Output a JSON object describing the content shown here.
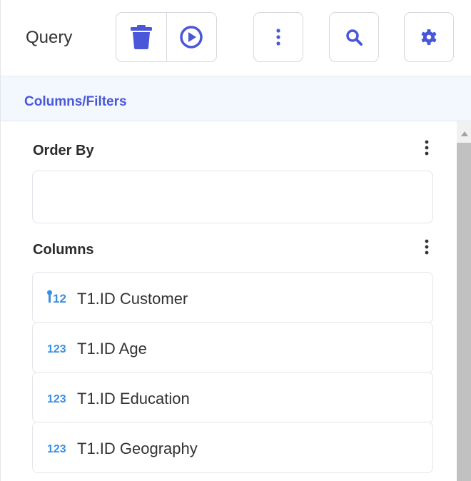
{
  "header": {
    "title": "Query",
    "buttons": {
      "delete_icon": "trash-icon",
      "run_icon": "play-circle-icon",
      "more_icon": "more-vertical-icon",
      "search_icon": "search-icon",
      "settings_icon": "gear-icon"
    }
  },
  "tabs": {
    "active_label": "Columns/Filters"
  },
  "order_by": {
    "title": "Order By",
    "items": []
  },
  "columns": {
    "title": "Columns",
    "items": [
      {
        "label": "T1.ID Customer",
        "type_icon": "key-number-icon",
        "type_text": "12"
      },
      {
        "label": "T1.ID Age",
        "type_icon": "number-type-icon",
        "type_text": "123"
      },
      {
        "label": "T1.ID Education",
        "type_icon": "number-type-icon",
        "type_text": "123"
      },
      {
        "label": "T1.ID Geography",
        "type_icon": "number-type-icon",
        "type_text": "123"
      }
    ]
  },
  "colors": {
    "accent": "#4a57d9",
    "type_icon": "#3b8fe0",
    "tab_background": "#f3f8fe"
  }
}
